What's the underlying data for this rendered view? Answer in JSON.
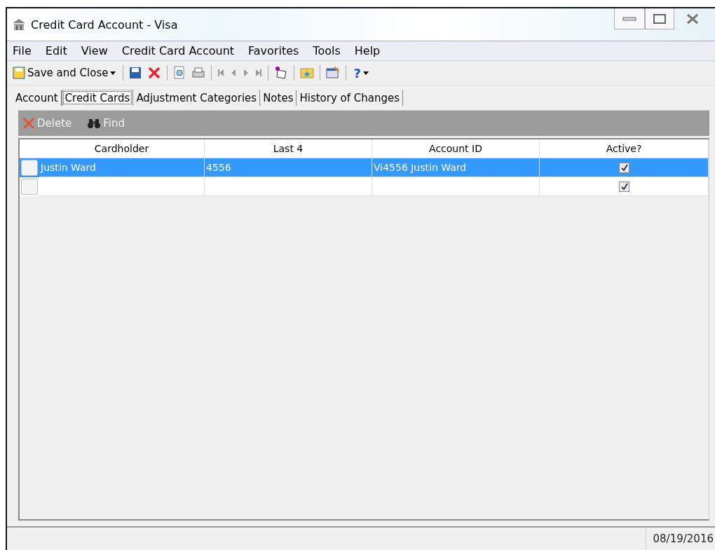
{
  "window": {
    "title": "Credit Card Account - Visa"
  },
  "menu": [
    "File",
    "Edit",
    "View",
    "Credit Card Account",
    "Favorites",
    "Tools",
    "Help"
  ],
  "toolbar": {
    "save_and_close": "Save and Close",
    "help": "?"
  },
  "tabs": [
    {
      "label": "Account",
      "selected": false
    },
    {
      "label": "Credit Cards",
      "selected": true
    },
    {
      "label": "Adjustment Categories",
      "selected": false
    },
    {
      "label": "Notes",
      "selected": false
    },
    {
      "label": "History of Changes",
      "selected": false
    }
  ],
  "actions": [
    {
      "kind": "delete",
      "label": "Delete"
    },
    {
      "kind": "find",
      "label": "Find"
    }
  ],
  "table": {
    "columns": [
      "Cardholder",
      "Last 4",
      "Account ID",
      "Active?"
    ],
    "rows": [
      {
        "cardholder": "Justin Ward",
        "last4": "4556",
        "account_id": "Vi4556 Justin Ward",
        "active": true,
        "selected": true
      },
      {
        "cardholder": "",
        "last4": "",
        "account_id": "",
        "active": true,
        "selected": false
      }
    ]
  },
  "status_bar": {
    "date": "08/19/2016"
  }
}
